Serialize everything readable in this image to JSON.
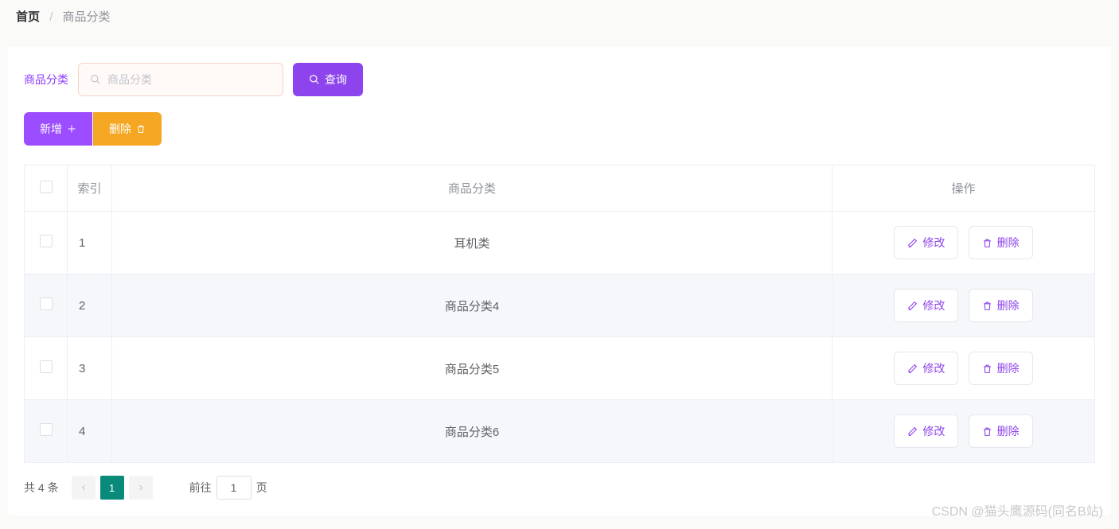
{
  "breadcrumb": {
    "home": "首页",
    "current": "商品分类"
  },
  "search": {
    "label": "商品分类",
    "placeholder": "商品分类",
    "query_btn": "查询"
  },
  "actions": {
    "add": "新增",
    "delete": "删除"
  },
  "table": {
    "headers": {
      "index": "索引",
      "category": "商品分类",
      "ops": "操作"
    },
    "rows": [
      {
        "idx": "1",
        "cat": "耳机类"
      },
      {
        "idx": "2",
        "cat": "商品分类4"
      },
      {
        "idx": "3",
        "cat": "商品分类5"
      },
      {
        "idx": "4",
        "cat": "商品分类6"
      }
    ],
    "ops": {
      "edit": "修改",
      "delete": "删除"
    }
  },
  "pagination": {
    "total": "共 4 条",
    "current_page": "1",
    "goto_prefix": "前往",
    "goto_suffix": "页",
    "goto_value": "1"
  },
  "watermark": "CSDN @猫头鹰源码(同名B站)"
}
